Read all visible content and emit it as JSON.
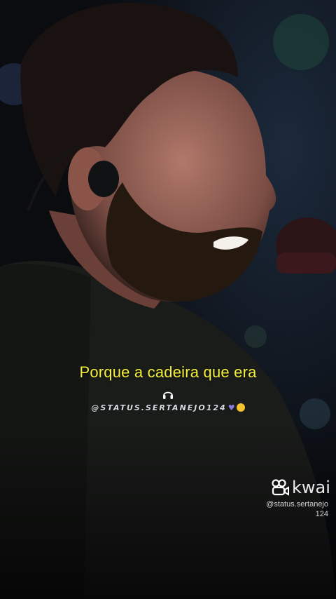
{
  "video": {
    "lyric_caption": "Porque a cadeira que era",
    "creator_tag": "@STATUS.SERTANEJO124",
    "headphone_icon": "headphone-icon",
    "emojis": [
      "purple-heart-icon",
      "sad-face-icon"
    ]
  },
  "watermark": {
    "brand": "kwai",
    "logo_icon": "kwai-logo-icon",
    "handle_line1": "@status.sertanejo",
    "handle_line2": "124"
  },
  "colors": {
    "caption": "#f2f03a",
    "background": "#0a0c10"
  }
}
